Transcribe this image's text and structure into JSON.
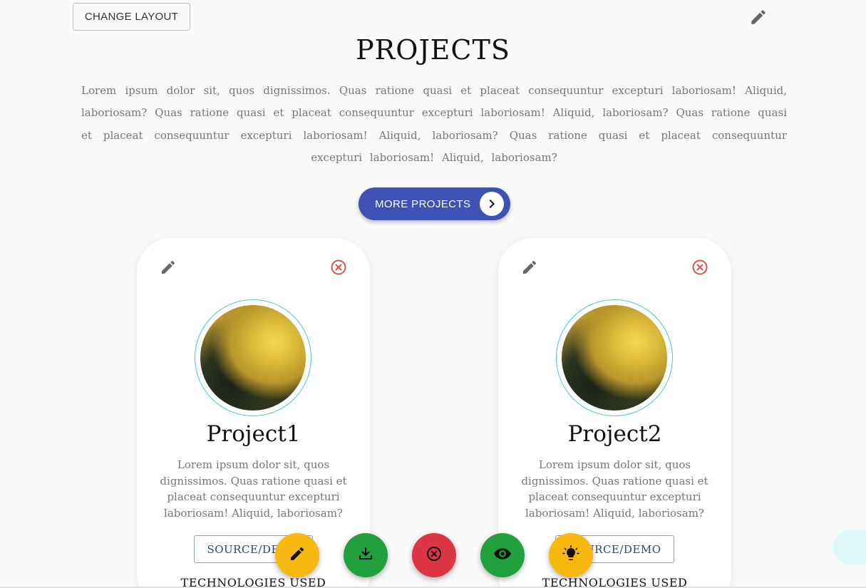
{
  "header": {
    "change_layout_label": "CHANGE LAYOUT",
    "title": "PROJECTS",
    "intro": "Lorem ipsum dolor sit, quos dignissimos. Quas ratione quasi et placeat consequuntur excepturi laboriosam! Aliquid, laboriosam? Quas ratione quasi et placeat consequuntur excepturi laboriosam! Aliquid, laboriosam? Quas ratione quasi et placeat consequuntur excepturi laboriosam! Aliquid, laboriosam? Quas ratione quasi et placeat consequuntur excepturi laboriosam! Aliquid, laboriosam?",
    "more_projects_label": "MORE PROJECTS"
  },
  "projects": [
    {
      "name": "Project1",
      "description": "Lorem ipsum dolor sit, quos dignissimos. Quas ratione quasi et placeat consequuntur excepturi laboriosam! Aliquid, laboriosam?",
      "source_label": "SOURCE/DEMO",
      "technologies_heading": "TECHNOLOGIES USED"
    },
    {
      "name": "Project2",
      "description": "Lorem ipsum dolor sit, quos dignissimos. Quas ratione quasi et placeat consequuntur excepturi laboriosam! Aliquid, laboriosam?",
      "source_label": "SOURCE/DEMO",
      "technologies_heading": "TECHNOLOGIES USED"
    }
  ],
  "fabs": [
    {
      "icon": "pencil-icon",
      "color": "#f6b80f"
    },
    {
      "icon": "download-icon",
      "color": "#22a03d"
    },
    {
      "icon": "close-circle-icon",
      "color": "#dc3545"
    },
    {
      "icon": "eye-icon",
      "color": "#22a03d"
    },
    {
      "icon": "lightbulb-icon",
      "color": "#f6b80f"
    }
  ],
  "colors": {
    "accent": "#3f51b5",
    "avatar_ring": "#4bc6d1",
    "close_icon": "#d9534f",
    "side_tab": "#dff6f8"
  }
}
